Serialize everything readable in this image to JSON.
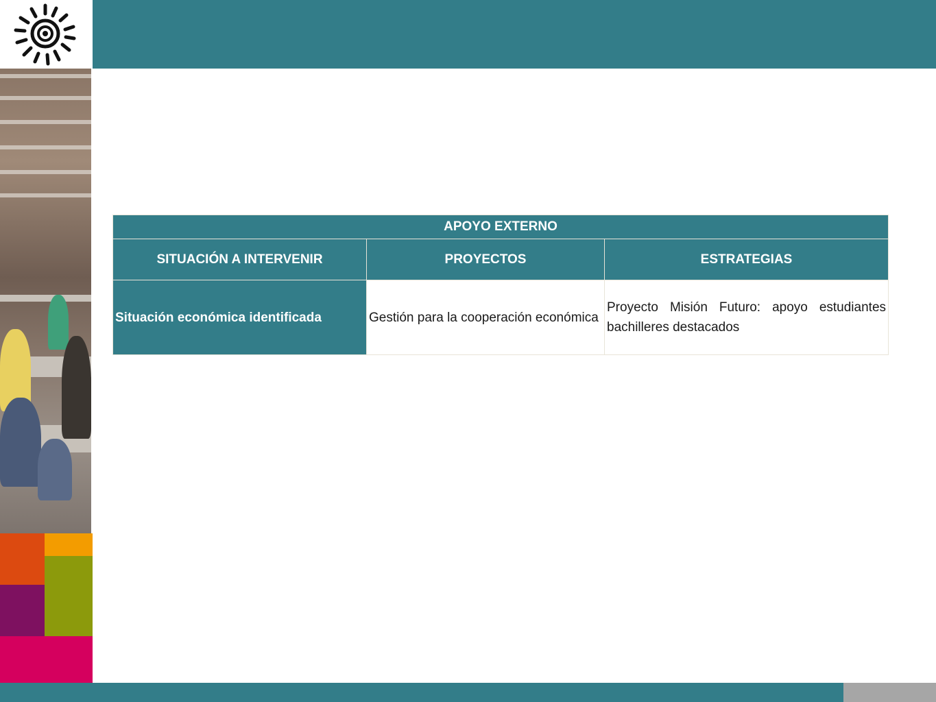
{
  "colors": {
    "teal": "#337d89",
    "orange_red": "#dc4a10",
    "orange": "#f39c00",
    "purple": "#7e1160",
    "olive": "#8c9a0c",
    "magenta": "#d5005e",
    "gray": "#a6a6a6"
  },
  "logo": {
    "icon": "sun-spiral-icon"
  },
  "photo": {
    "icon": "students-library-photo"
  },
  "table": {
    "header": "APOYO EXTERNO",
    "columns": [
      "SITUACIÓN A INTERVENIR",
      "PROYECTOS",
      "ESTRATEGIAS"
    ],
    "rows": [
      {
        "situacion": "Situación económica identificada",
        "proyectos": "Gestión para la cooperación económica",
        "estrategias": "Proyecto Misión Futuro: apoyo estudiantes bachilleres destacados"
      }
    ]
  }
}
